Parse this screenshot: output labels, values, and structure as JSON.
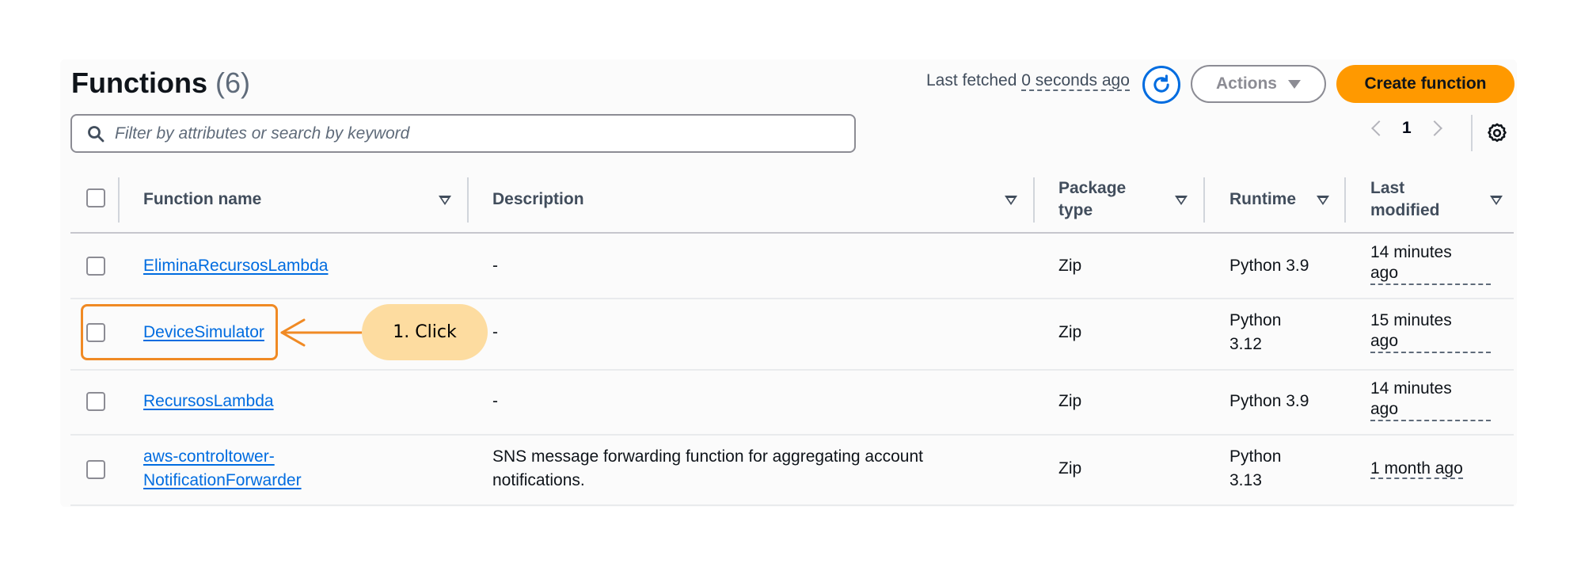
{
  "header": {
    "title": "Functions",
    "count": "(6)",
    "last_fetched_label": "Last fetched",
    "last_fetched_value": "0 seconds ago",
    "actions_label": "Actions",
    "create_label": "Create function"
  },
  "search": {
    "placeholder": "Filter by attributes or search by keyword"
  },
  "pagination": {
    "current_page": "1"
  },
  "table": {
    "columns": {
      "name": "Function name",
      "description": "Description",
      "package_line1": "Package",
      "package_line2": "type",
      "runtime": "Runtime",
      "modified_line1": "Last",
      "modified_line2": "modified"
    },
    "rows": [
      {
        "name": "EliminaRecursosLambda",
        "description": "-",
        "package": "Zip",
        "runtime": "Python 3.9",
        "modified_line1": "14 minutes",
        "modified_line2": "ago"
      },
      {
        "name": "DeviceSimulator",
        "description": "-",
        "package": "Zip",
        "runtime_line1": "Python",
        "runtime_line2": "3.12",
        "modified_line1": "15 minutes",
        "modified_line2": "ago"
      },
      {
        "name": "RecursosLambda",
        "description": "-",
        "package": "Zip",
        "runtime": "Python 3.9",
        "modified_line1": "14 minutes",
        "modified_line2": "ago"
      },
      {
        "name_line1": "aws-controltower-",
        "name_line2": "NotificationForwarder",
        "description_line1": "SNS message forwarding function for aggregating account",
        "description_line2": "notifications.",
        "package": "Zip",
        "runtime_line1": "Python",
        "runtime_line2": "3.13",
        "modified": "1 month ago"
      }
    ]
  },
  "annotation": {
    "label": "1. Click"
  },
  "colors": {
    "accent": "#006ce0",
    "primary_button": "#ff9900",
    "highlight": "#f08a24",
    "callout_bg": "#fddca0"
  }
}
